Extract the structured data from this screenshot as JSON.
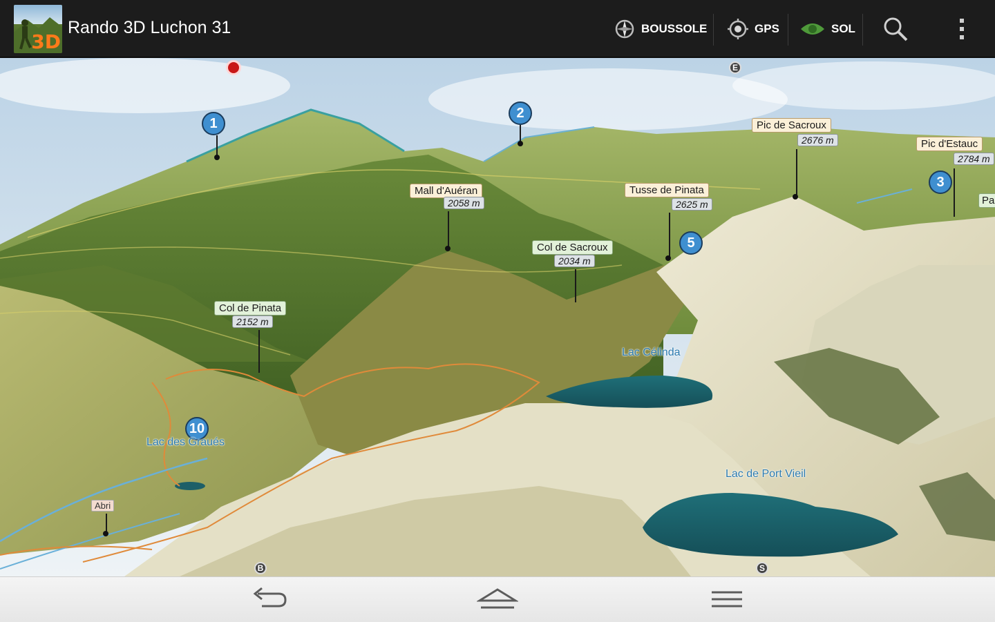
{
  "app": {
    "title": "Rando 3D Luchon 31",
    "icon_badge": "3D"
  },
  "actions": [
    {
      "id": "compass",
      "label": "BOUSSOLE",
      "icon": "compass-icon"
    },
    {
      "id": "gps",
      "label": "GPS",
      "icon": "gps-target-icon"
    },
    {
      "id": "ground",
      "label": "SOL",
      "icon": "eye-icon",
      "icon_color": "#4f9a3a"
    },
    {
      "id": "search",
      "icon": "search-icon"
    },
    {
      "id": "overflow",
      "icon": "overflow-menu-icon"
    }
  ],
  "map": {
    "summits": [
      {
        "name": "Pic de Sacroux",
        "elevation": "2676 m"
      },
      {
        "name": "Pic d'Estauc",
        "elevation": "2784 m"
      },
      {
        "name": "Mall d'Auéran",
        "elevation": "2058 m"
      },
      {
        "name": "Tusse de Pinata",
        "elevation": "2625 m"
      },
      {
        "name": "Col de Sacroux",
        "elevation": "2034 m"
      },
      {
        "name": "Col de Pinata",
        "elevation": "2152 m"
      }
    ],
    "waypoints": [
      "1",
      "2",
      "3",
      "5",
      "10"
    ],
    "lakes": [
      {
        "name": "Lac Célinda"
      },
      {
        "name": "Lac des Graués"
      },
      {
        "name": "Lac de Port Vieil"
      }
    ],
    "shelter_label": "Abri",
    "edge_markers": [
      "E",
      "S",
      "B"
    ],
    "edge_tag": "Pa"
  },
  "navbar": [
    {
      "id": "back",
      "icon": "back-icon"
    },
    {
      "id": "home",
      "icon": "home-icon"
    },
    {
      "id": "menu",
      "icon": "menu-icon"
    }
  ]
}
